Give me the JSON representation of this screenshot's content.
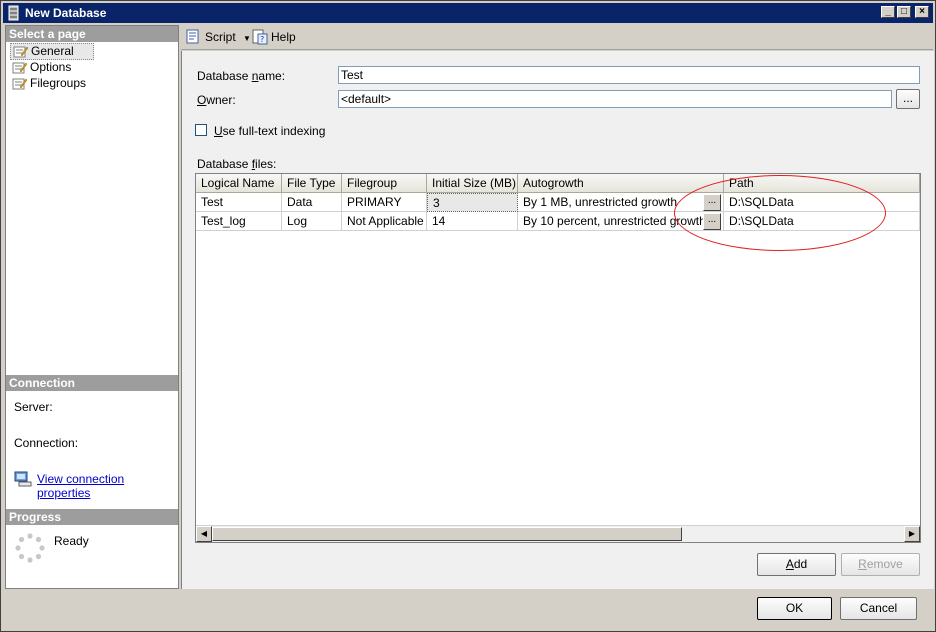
{
  "window": {
    "title": "New Database"
  },
  "left": {
    "select_page": "Select a page",
    "pages": [
      {
        "label": "General"
      },
      {
        "label": "Options"
      },
      {
        "label": "Filegroups"
      }
    ],
    "connection": {
      "header": "Connection",
      "server_label": "Server:",
      "connection_label": "Connection:",
      "view_link": "View connection properties"
    },
    "progress": {
      "header": "Progress",
      "status": "Ready"
    }
  },
  "toolbar": {
    "script": "Script",
    "help": "Help"
  },
  "form": {
    "db_name_label_pre": "Database ",
    "db_name_label_u": "n",
    "db_name_label_post": "ame:",
    "db_name_value": "Test",
    "owner_label_u": "O",
    "owner_label_post": "wner:",
    "owner_value": "<default>",
    "fulltext_u": "U",
    "fulltext_post": "se full-text indexing",
    "files_label_pre": "Database ",
    "files_label_u": "f",
    "files_label_post": "iles:"
  },
  "grid": {
    "columns": [
      "Logical Name",
      "File Type",
      "Filegroup",
      "Initial Size (MB)",
      "Autogrowth",
      "Path"
    ],
    "rows": [
      [
        "Test",
        "Data",
        "PRIMARY",
        "3",
        "By 1 MB, unrestricted growth",
        "D:\\SQLData"
      ],
      [
        "Test_log",
        "Log",
        "Not Applicable",
        "14",
        "By 10 percent, unrestricted growth",
        "D:\\SQLData"
      ]
    ],
    "ellipsis": "..."
  },
  "buttons": {
    "add_u": "A",
    "add_post": "dd",
    "remove_u": "R",
    "remove_post": "emove",
    "ok": "OK",
    "cancel": "Cancel",
    "browse": "..."
  },
  "colors": {
    "title_bar": "#0a246a",
    "annotation": "#e02020",
    "link": "#0000cc"
  }
}
